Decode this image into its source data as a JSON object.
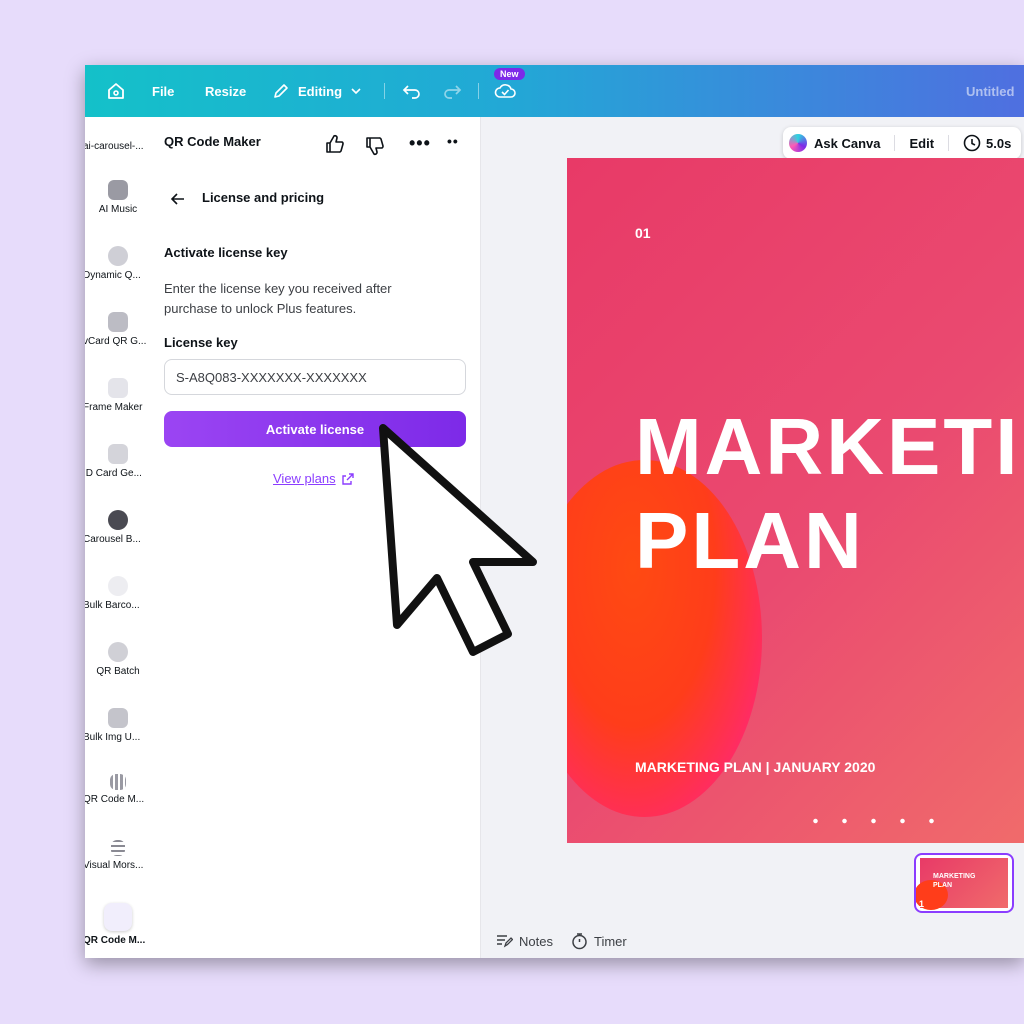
{
  "topbar": {
    "file_label": "File",
    "resize_label": "Resize",
    "editing_label": "Editing",
    "new_badge": "New",
    "doc_title": "Untitled"
  },
  "rail": {
    "items": [
      {
        "label": "ai-carousel-..."
      },
      {
        "label": "AI Music"
      },
      {
        "label": "Dynamic Q..."
      },
      {
        "label": "vCard QR G..."
      },
      {
        "label": "Frame Maker"
      },
      {
        "label": "ID Card Ge..."
      },
      {
        "label": "Carousel B..."
      },
      {
        "label": "Bulk Barco..."
      },
      {
        "label": "QR Batch"
      },
      {
        "label": "Bulk Img U..."
      },
      {
        "label": "QR Code M..."
      },
      {
        "label": "Visual Mors..."
      },
      {
        "label": "QR Code M..."
      }
    ]
  },
  "panel": {
    "app_title": "QR Code Maker",
    "back_label": "License and pricing",
    "section_title": "Activate license key",
    "description": "Enter the license key you received after purchase to unlock Plus features.",
    "field_label": "License key",
    "license_value": "S-A8Q083-XXXXXXX-XXXXXXX",
    "activate_button": "Activate license",
    "view_plans": "View plans"
  },
  "canvas": {
    "ask_canva": "Ask Canva",
    "edit": "Edit",
    "duration": "5.0s",
    "slide": {
      "number": "01",
      "title_line1": "MARKETING",
      "title_line2": "PLAN",
      "footer": "MARKETING PLAN | JANUARY 2020"
    },
    "thumbnail": {
      "title_line1": "MARKETING",
      "title_line2": "PLAN",
      "page_number": "1"
    }
  },
  "bottombar": {
    "notes": "Notes",
    "timer": "Timer"
  },
  "colors": {
    "accent_purple": "#7d2ae8",
    "topbar_start": "#14c1c9",
    "topbar_end": "#4f6fe0",
    "slide_pink": "#e83a67",
    "blob_orange": "#ff3d1a",
    "background_lavender": "#e7dcfb"
  }
}
